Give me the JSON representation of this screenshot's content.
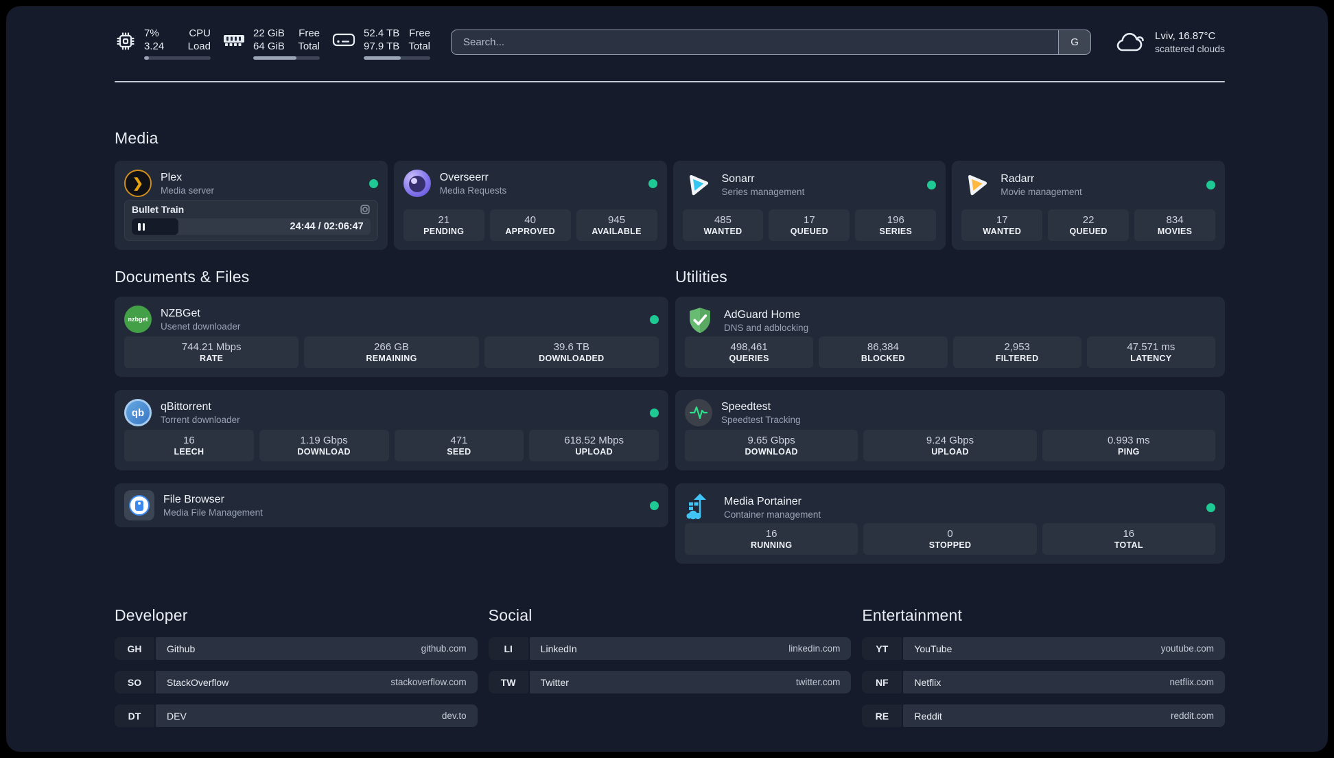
{
  "colors": {
    "online": "#1ec993",
    "accent_plex": "#e5a00d",
    "accent_sonarr": "#35c5f1",
    "accent_radarr": "#ffb83d"
  },
  "header": {
    "cpu": {
      "line1": "7%",
      "line2": "3.24",
      "label1": "CPU",
      "label2": "Load",
      "progress_pct": 7
    },
    "memory": {
      "line1": "22 GiB",
      "line2": "64 GiB",
      "label1": "Free",
      "label2": "Total",
      "progress_pct": 65
    },
    "disk": {
      "line1": "52.4 TB",
      "line2": "97.9 TB",
      "label1": "Free",
      "label2": "Total",
      "progress_pct": 56
    },
    "search": {
      "placeholder": "Search...",
      "engine_button": "G"
    },
    "weather": {
      "location": "Lviv, 16.87°C",
      "condition": "scattered clouds"
    }
  },
  "sections": {
    "media": {
      "title": "Media"
    },
    "documents": {
      "title": "Documents & Files"
    },
    "utilities": {
      "title": "Utilities"
    }
  },
  "apps": {
    "plex": {
      "name": "Plex",
      "subtitle": "Media server",
      "icon_glyph": "❯",
      "player": {
        "title": "Bullet Train",
        "time": "24:44 / 02:06:47",
        "progress_pct": 19.5
      }
    },
    "overseerr": {
      "name": "Overseerr",
      "subtitle": "Media Requests",
      "stats": [
        {
          "value": "21",
          "label": "PENDING"
        },
        {
          "value": "40",
          "label": "APPROVED"
        },
        {
          "value": "945",
          "label": "AVAILABLE"
        }
      ]
    },
    "sonarr": {
      "name": "Sonarr",
      "subtitle": "Series management",
      "stats": [
        {
          "value": "485",
          "label": "WANTED"
        },
        {
          "value": "17",
          "label": "QUEUED"
        },
        {
          "value": "196",
          "label": "SERIES"
        }
      ]
    },
    "radarr": {
      "name": "Radarr",
      "subtitle": "Movie management",
      "stats": [
        {
          "value": "17",
          "label": "WANTED"
        },
        {
          "value": "22",
          "label": "QUEUED"
        },
        {
          "value": "834",
          "label": "MOVIES"
        }
      ]
    },
    "nzbget": {
      "name": "NZBGet",
      "subtitle": "Usenet downloader",
      "icon_text": "nzbget",
      "stats": [
        {
          "value": "744.21 Mbps",
          "label": "RATE"
        },
        {
          "value": "266 GB",
          "label": "REMAINING"
        },
        {
          "value": "39.6 TB",
          "label": "DOWNLOADED"
        }
      ]
    },
    "qbittorrent": {
      "name": "qBittorrent",
      "subtitle": "Torrent downloader",
      "icon_text": "qb",
      "stats": [
        {
          "value": "16",
          "label": "LEECH"
        },
        {
          "value": "1.19 Gbps",
          "label": "DOWNLOAD"
        },
        {
          "value": "471",
          "label": "SEED"
        },
        {
          "value": "618.52 Mbps",
          "label": "UPLOAD"
        }
      ]
    },
    "filebrowser": {
      "name": "File Browser",
      "subtitle": "Media File Management"
    },
    "adguard": {
      "name": "AdGuard Home",
      "subtitle": "DNS and adblocking",
      "stats": [
        {
          "value": "498,461",
          "label": "QUERIES"
        },
        {
          "value": "86,384",
          "label": "BLOCKED"
        },
        {
          "value": "2,953",
          "label": "FILTERED"
        },
        {
          "value": "47.571 ms",
          "label": "LATENCY"
        }
      ]
    },
    "speedtest": {
      "name": "Speedtest",
      "subtitle": "Speedtest Tracking",
      "stats": [
        {
          "value": "9.65 Gbps",
          "label": "DOWNLOAD"
        },
        {
          "value": "9.24 Gbps",
          "label": "UPLOAD"
        },
        {
          "value": "0.993 ms",
          "label": "PING"
        }
      ]
    },
    "portainer": {
      "name": "Media Portainer",
      "subtitle": "Container management",
      "stats": [
        {
          "value": "16",
          "label": "RUNNING"
        },
        {
          "value": "0",
          "label": "STOPPED"
        },
        {
          "value": "16",
          "label": "TOTAL"
        }
      ]
    }
  },
  "bookmarks": {
    "developer": {
      "title": "Developer",
      "links": [
        {
          "abbr": "GH",
          "name": "Github",
          "href": "github.com"
        },
        {
          "abbr": "SO",
          "name": "StackOverflow",
          "href": "stackoverflow.com"
        },
        {
          "abbr": "DT",
          "name": "DEV",
          "href": "dev.to"
        }
      ]
    },
    "social": {
      "title": "Social",
      "links": [
        {
          "abbr": "LI",
          "name": "LinkedIn",
          "href": "linkedin.com"
        },
        {
          "abbr": "TW",
          "name": "Twitter",
          "href": "twitter.com"
        }
      ]
    },
    "entertainment": {
      "title": "Entertainment",
      "links": [
        {
          "abbr": "YT",
          "name": "YouTube",
          "href": "youtube.com"
        },
        {
          "abbr": "NF",
          "name": "Netflix",
          "href": "netflix.com"
        },
        {
          "abbr": "RE",
          "name": "Reddit",
          "href": "reddit.com"
        }
      ]
    }
  }
}
